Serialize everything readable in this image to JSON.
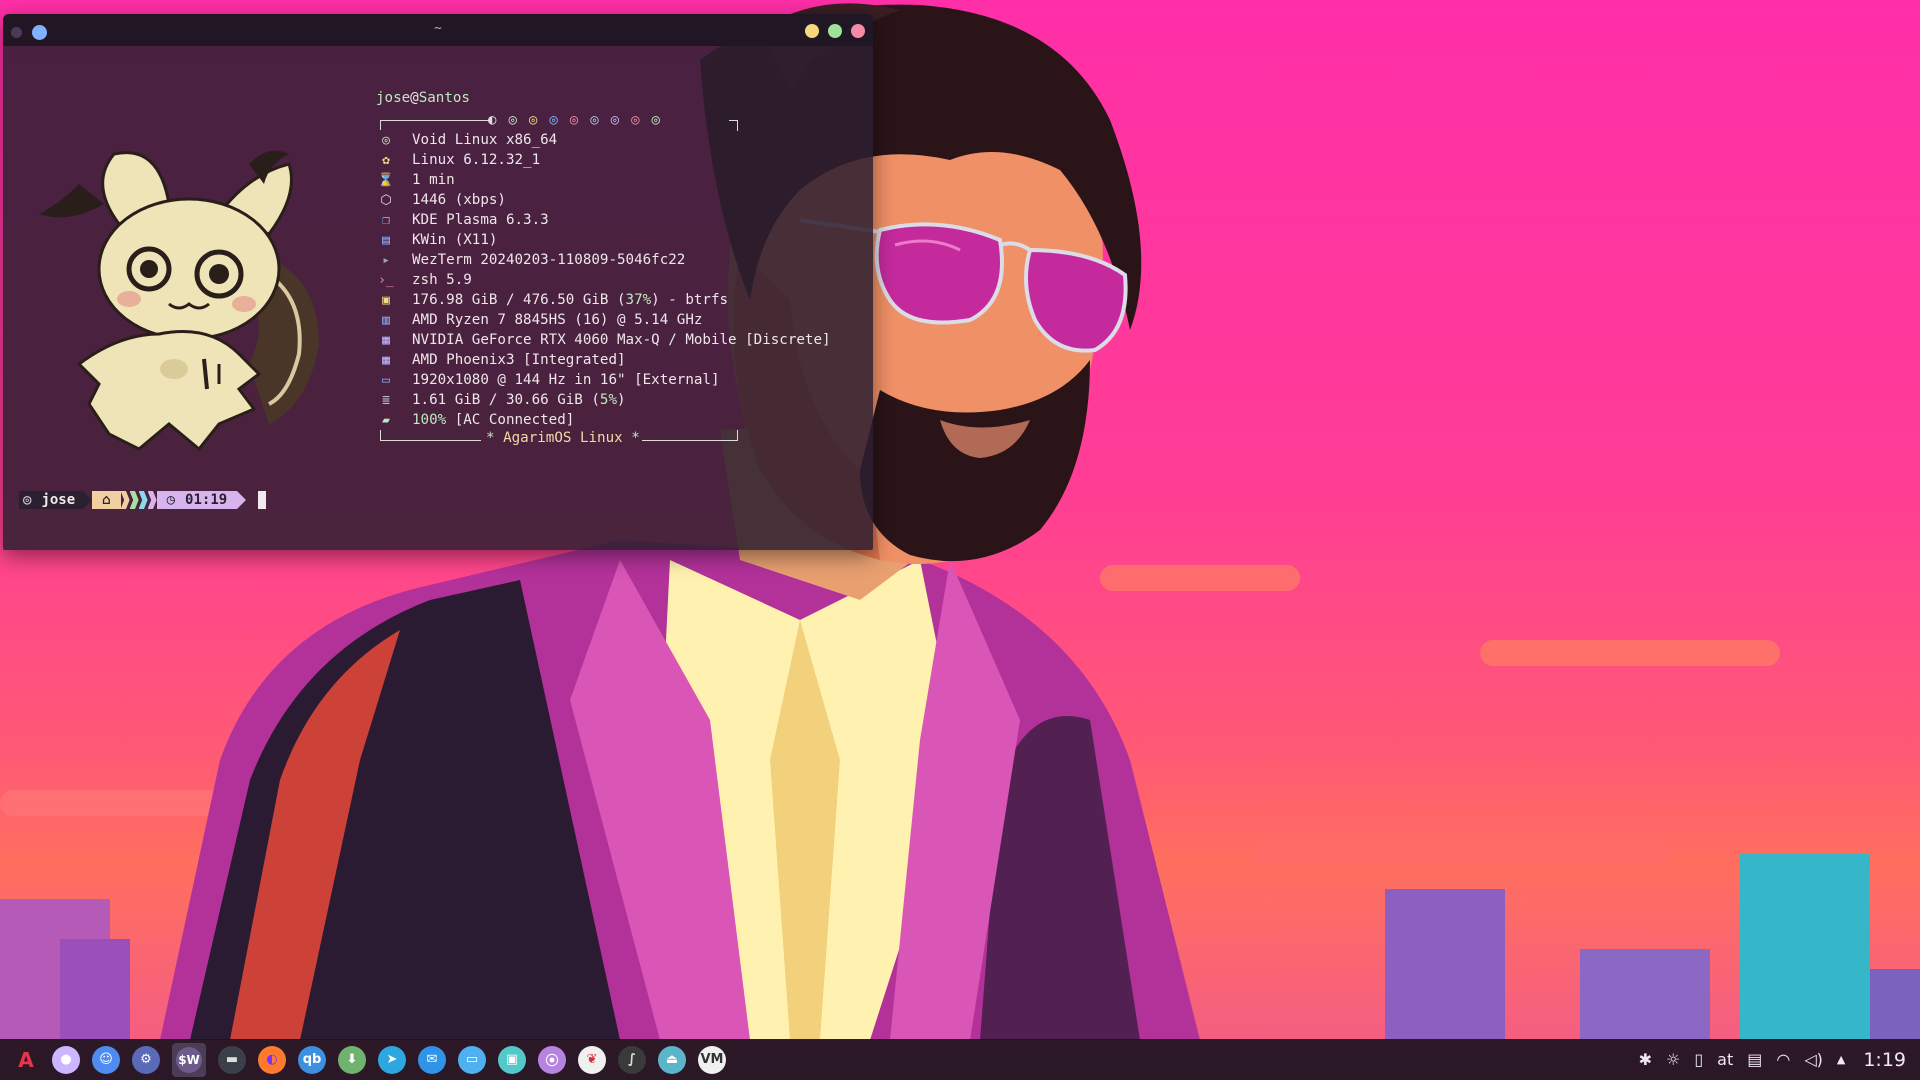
{
  "window": {
    "title": "~",
    "buttons": {
      "minimize_color": "#f6d77e",
      "maximize_color": "#9ee29a",
      "close_color": "#f38ba8"
    }
  },
  "fetch": {
    "user": "jose",
    "at": "@",
    "host": "Santos",
    "rows": [
      {
        "icon": "void-logo-icon",
        "glyph": "◎",
        "color": "#bfe8c0",
        "value": "Void Linux x86_64"
      },
      {
        "icon": "gear-icon",
        "glyph": "✿",
        "color": "#f6d77e",
        "value": "Linux 6.12.32_1"
      },
      {
        "icon": "hourglass-icon",
        "glyph": "⌛",
        "color": "#8ab4ff",
        "value": "1 min"
      },
      {
        "icon": "package-icon",
        "glyph": "⬡",
        "color": "#e6d7f0",
        "value": "1446 (xbps)"
      },
      {
        "icon": "desktop-icon",
        "glyph": "❐",
        "color": "#8ab4ff",
        "value": "KDE Plasma 6.3.3"
      },
      {
        "icon": "window-icon",
        "glyph": "▤",
        "color": "#8ab4ff",
        "value": "KWin (X11)"
      },
      {
        "icon": "terminal-icon",
        "glyph": "▸",
        "color": "#9aa4b4",
        "value": "WezTerm 20240203-110809-5046fc22"
      },
      {
        "icon": "shell-icon",
        "glyph": "›_",
        "color": "#f38ba8",
        "value": "zsh 5.9"
      },
      {
        "icon": "disk-icon",
        "glyph": "▣",
        "color": "#f6d77e",
        "value_pre": "176.98 GiB / 476.50 GiB (",
        "value_hl": "37%",
        "value_post": ") - btrfs"
      },
      {
        "icon": "cpu-icon",
        "glyph": "▥",
        "color": "#8ab4ff",
        "value": "AMD Ryzen 7 8845HS (16) @ 5.14 GHz"
      },
      {
        "icon": "gpu-icon",
        "glyph": "▦",
        "color": "#c4b5ff",
        "value": "NVIDIA GeForce RTX 4060 Max-Q / Mobile [Discrete]"
      },
      {
        "icon": "gpu-icon",
        "glyph": "▦",
        "color": "#c4b5ff",
        "value": "AMD Phoenix3 [Integrated]"
      },
      {
        "icon": "monitor-icon",
        "glyph": "▭",
        "color": "#8ab4ff",
        "value": "1920x1080 @ 144 Hz in 16\" [External]"
      },
      {
        "icon": "memory-icon",
        "glyph": "≣",
        "color": "#b8b8c8",
        "value_pre": "1.61 GiB / 30.66 GiB (",
        "value_hl": "5%",
        "value_post": ")"
      },
      {
        "icon": "battery-icon",
        "glyph": "▰",
        "color": "#bfe8c0",
        "value_pre": "",
        "value_hl": "100%",
        "value_post": " [AC Connected]"
      }
    ],
    "footer": {
      "star": "*",
      "name": "AgarimOS Linux"
    }
  },
  "prompt": {
    "user": "jose",
    "time": "01:19",
    "colors": {
      "home": "#f2cfa0",
      "time": "#d8b4ee"
    },
    "stripe_colors": [
      "#f2cfa0",
      "#a6e3a1",
      "#89dceb",
      "#d8b4ee"
    ]
  },
  "taskbar": {
    "apps": [
      {
        "name": "app-launcher",
        "label": "A",
        "bg": "transparent",
        "fg": "#e8344c"
      },
      {
        "name": "app-purple-circle",
        "label": "●",
        "bg": "#cbb6ff",
        "fg": "#fff"
      },
      {
        "name": "app-finder",
        "label": "☺",
        "bg": "#4f8cf0",
        "fg": "#fff"
      },
      {
        "name": "app-settings",
        "label": "⚙",
        "bg": "#5a6ab8",
        "fg": "#fff"
      },
      {
        "name": "app-wezterm",
        "label": "$W",
        "bg": "#6f5b8b",
        "fg": "#fff",
        "active": true
      },
      {
        "name": "app-terminal",
        "label": "▬",
        "bg": "#3b3f4a",
        "fg": "#ddd"
      },
      {
        "name": "app-firefox",
        "label": "◐",
        "bg": "#ff7a2f",
        "fg": "#7a2fff"
      },
      {
        "name": "app-qbittorrent",
        "label": "qb",
        "bg": "#3d8fe0",
        "fg": "#fff"
      },
      {
        "name": "app-downloader",
        "label": "⬇",
        "bg": "#6fb36f",
        "fg": "#fff"
      },
      {
        "name": "app-telegram",
        "label": "➤",
        "bg": "#2ea6e0",
        "fg": "#fff"
      },
      {
        "name": "app-messenger",
        "label": "✉",
        "bg": "#2f93e6",
        "fg": "#fff"
      },
      {
        "name": "app-files",
        "label": "▭",
        "bg": "#4fb0f0",
        "fg": "#fff"
      },
      {
        "name": "app-remote-desktop",
        "label": "▣",
        "bg": "#52c8c8",
        "fg": "#fff"
      },
      {
        "name": "app-podcast",
        "label": "⦿",
        "bg": "#b783e0",
        "fg": "#fff"
      },
      {
        "name": "app-strawberry",
        "label": "❦",
        "bg": "#f0f0f0",
        "fg": "#d0303a"
      },
      {
        "name": "app-inkscape",
        "label": "∫",
        "bg": "#3a3a3a",
        "fg": "#ddd"
      },
      {
        "name": "app-disk-manager",
        "label": "⏏",
        "bg": "#5bb5c8",
        "fg": "#fff"
      },
      {
        "name": "app-vm",
        "label": "VM",
        "bg": "#f0f0f0",
        "fg": "#333"
      }
    ],
    "tray": {
      "bluetooth": "✱",
      "brightness": "☼",
      "phone": "▯",
      "keyboard_layout": "at",
      "clipboard": "▤",
      "wifi": "◠",
      "volume": "◁)",
      "expand": "▲",
      "clock": "1:19"
    }
  }
}
